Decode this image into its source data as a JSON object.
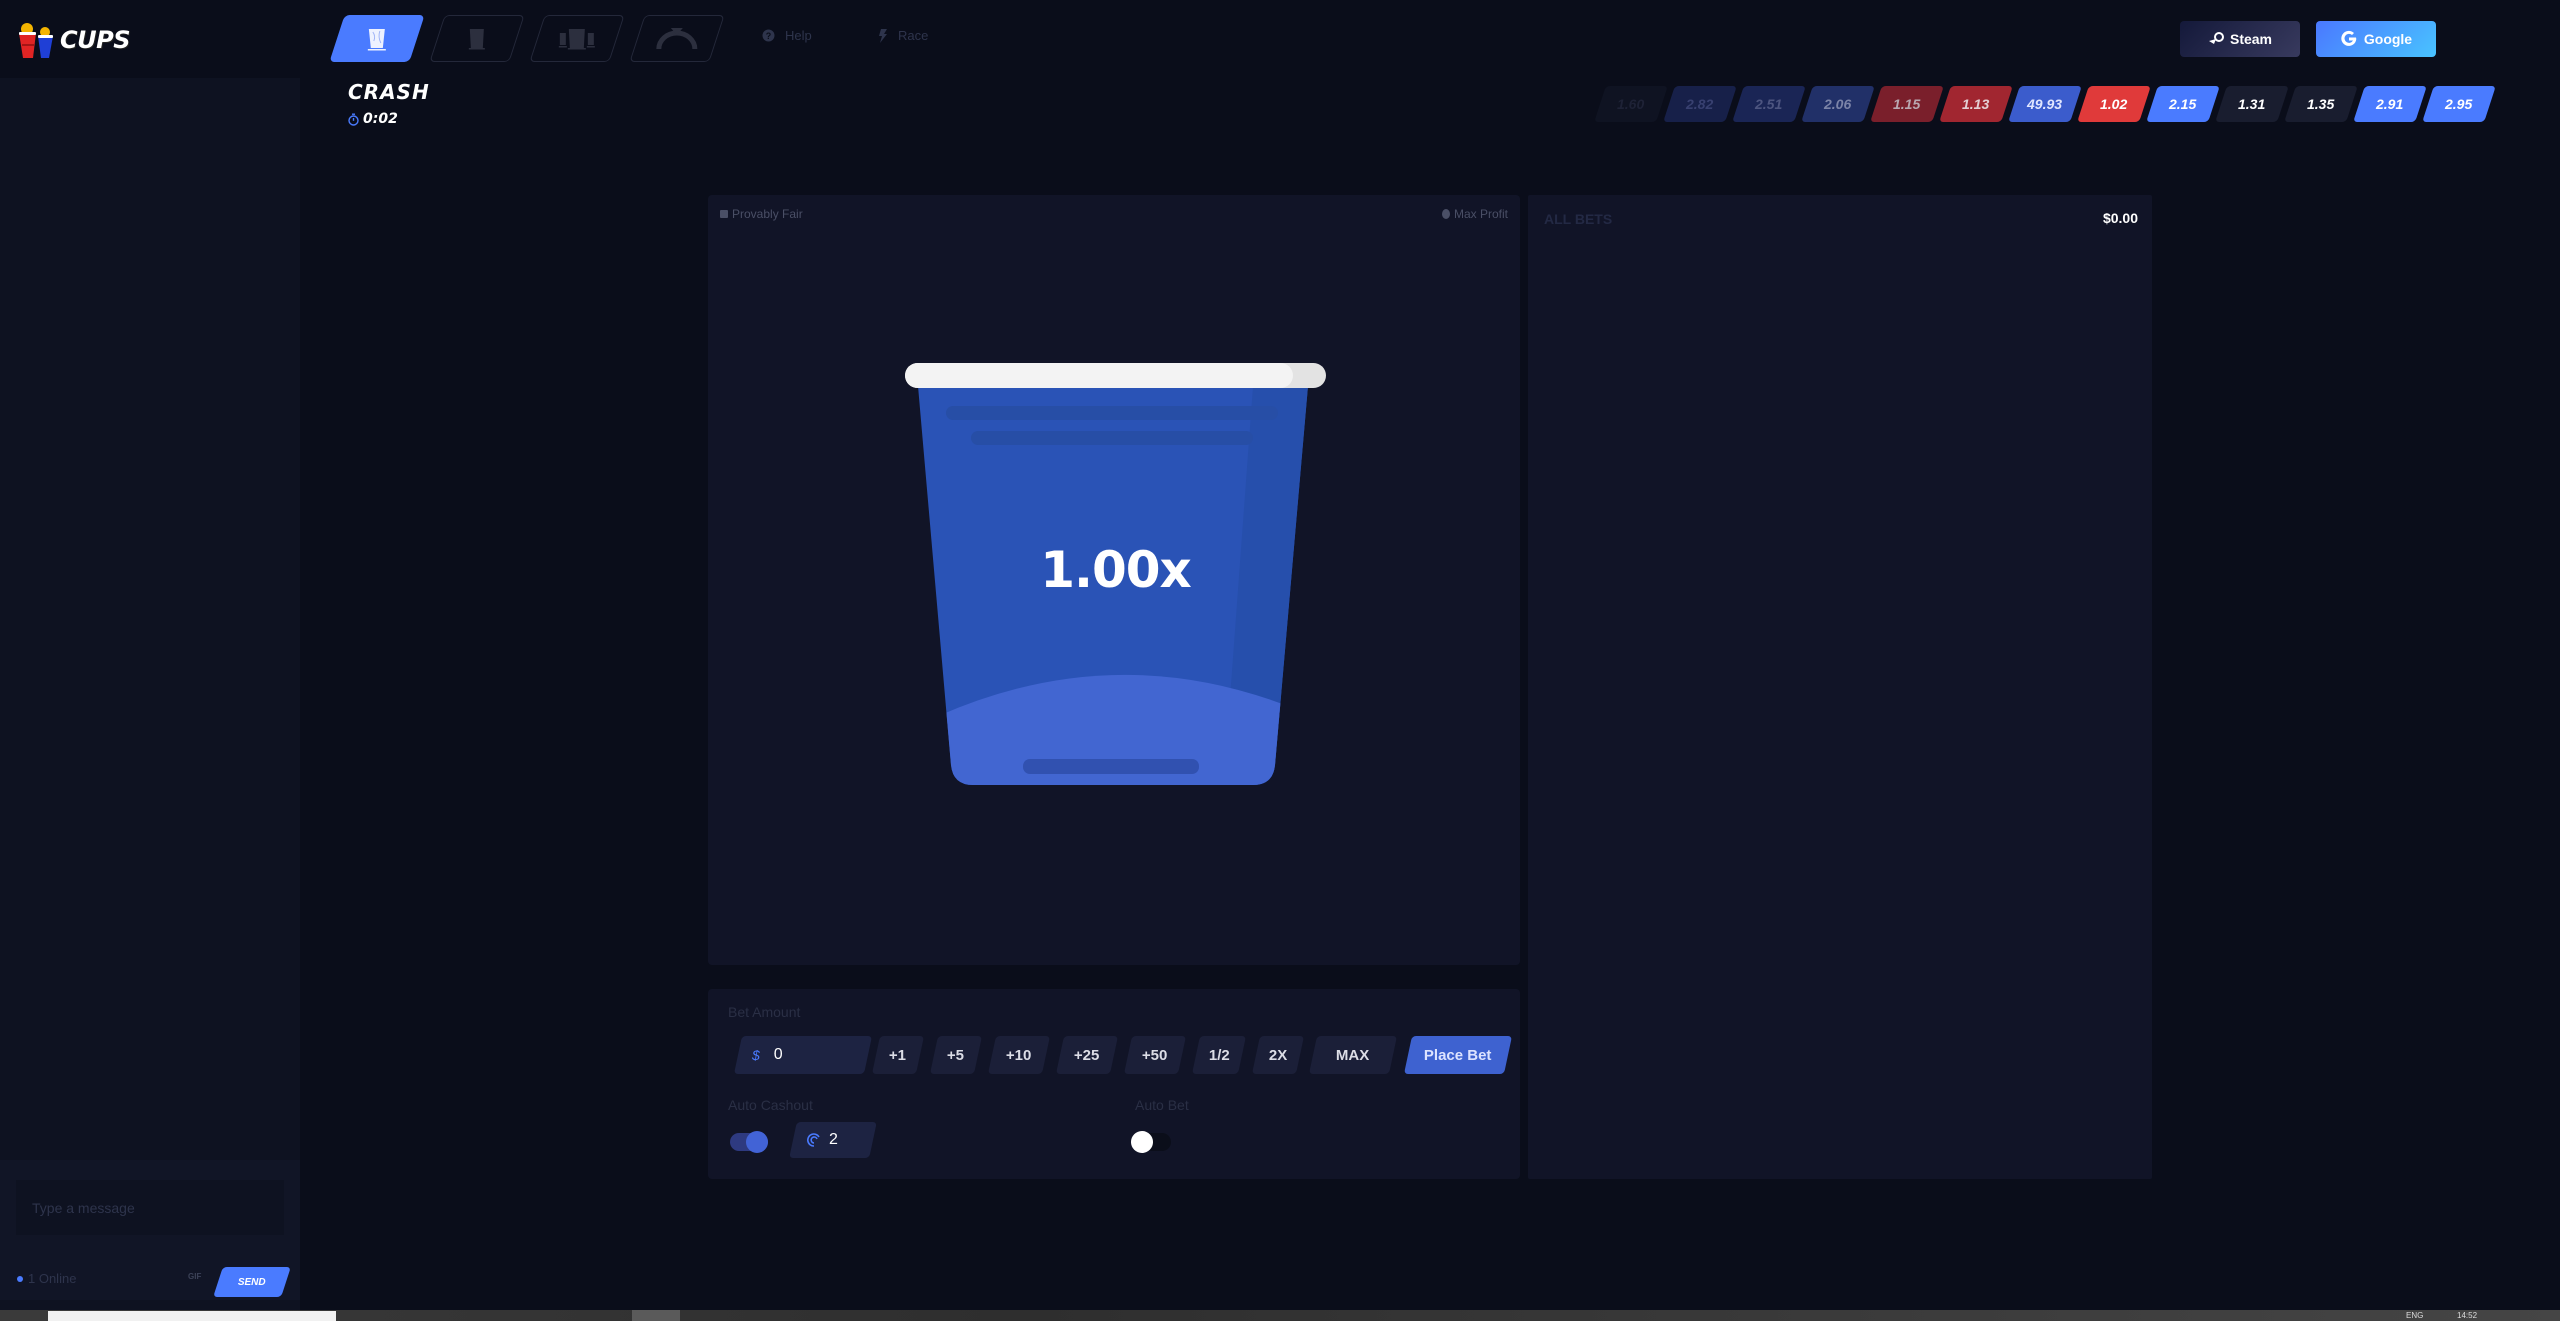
{
  "brand": {
    "name": "CUPS"
  },
  "nav": {
    "game_tabs": [
      {
        "name": "crash",
        "icon": "single-cup-icon",
        "active": true
      },
      {
        "name": "cup",
        "icon": "cup-icon",
        "active": false
      },
      {
        "name": "cups-battle",
        "icon": "triple-cup-icon",
        "active": false
      },
      {
        "name": "arc",
        "icon": "arc-icon",
        "active": false
      }
    ],
    "links": [
      {
        "label": "Help",
        "icon": "question-circle-icon"
      },
      {
        "label": "Race",
        "icon": "lightning-icon"
      }
    ],
    "auth": {
      "steam_label": "Steam",
      "google_label": "Google"
    }
  },
  "game": {
    "title": "CRASH",
    "timer": "0:02",
    "multiplier": "1.00x",
    "provably_fair_label": "Provably Fair",
    "max_profit_label": "Max Profit"
  },
  "history": [
    {
      "value": "1.60",
      "color": "#0f1322",
      "text": "#1e2236"
    },
    {
      "value": "2.82",
      "color": "#172049",
      "text": "#384070"
    },
    {
      "value": "2.51",
      "color": "#1a2555",
      "text": "#4d5580"
    },
    {
      "value": "2.06",
      "color": "#213068",
      "text": "#7c84a8"
    },
    {
      "value": "1.15",
      "color": "#7a1f2b",
      "text": "#b9a7b0"
    },
    {
      "value": "1.13",
      "color": "#a12630",
      "text": "#e4cfd3"
    },
    {
      "value": "49.93",
      "color": "#3b5ccc",
      "text": "#e0e6ff"
    },
    {
      "value": "1.02",
      "color": "#e03a3a",
      "text": "#ffffff"
    },
    {
      "value": "2.15",
      "color": "#4a7bff",
      "text": "#ffffff"
    },
    {
      "value": "1.31",
      "color": "#191d2f",
      "text": "#ffffff"
    },
    {
      "value": "1.35",
      "color": "#191d2f",
      "text": "#ffffff"
    },
    {
      "value": "2.91",
      "color": "#4a7bff",
      "text": "#ffffff"
    },
    {
      "value": "2.95",
      "color": "#4a7bff",
      "text": "#ffffff"
    }
  ],
  "bet": {
    "amount_label": "Bet Amount",
    "amount_value": "0",
    "currency_symbol": "$",
    "quick_buttons": [
      "+1",
      "+5",
      "+10",
      "+25",
      "+50",
      "1/2",
      "2X",
      "MAX"
    ],
    "place_bet_label": "Place Bet",
    "auto_cashout_label": "Auto Cashout",
    "auto_cashout_enabled": true,
    "auto_cashout_value": "2",
    "auto_bet_label": "Auto Bet",
    "auto_bet_enabled": false
  },
  "all_bets": {
    "title": "ALL BETS",
    "total": "$0.00"
  },
  "chat": {
    "placeholder": "Type a message",
    "online_text": "1 Online",
    "gif_label": "GIF",
    "send_label": "SEND"
  },
  "colors": {
    "accent": "#4a7bff",
    "danger": "#e03a3a",
    "panel": "#111427",
    "background": "#0a0d1a"
  },
  "taskbar": {
    "lang": "ENG",
    "time": "14:52"
  }
}
